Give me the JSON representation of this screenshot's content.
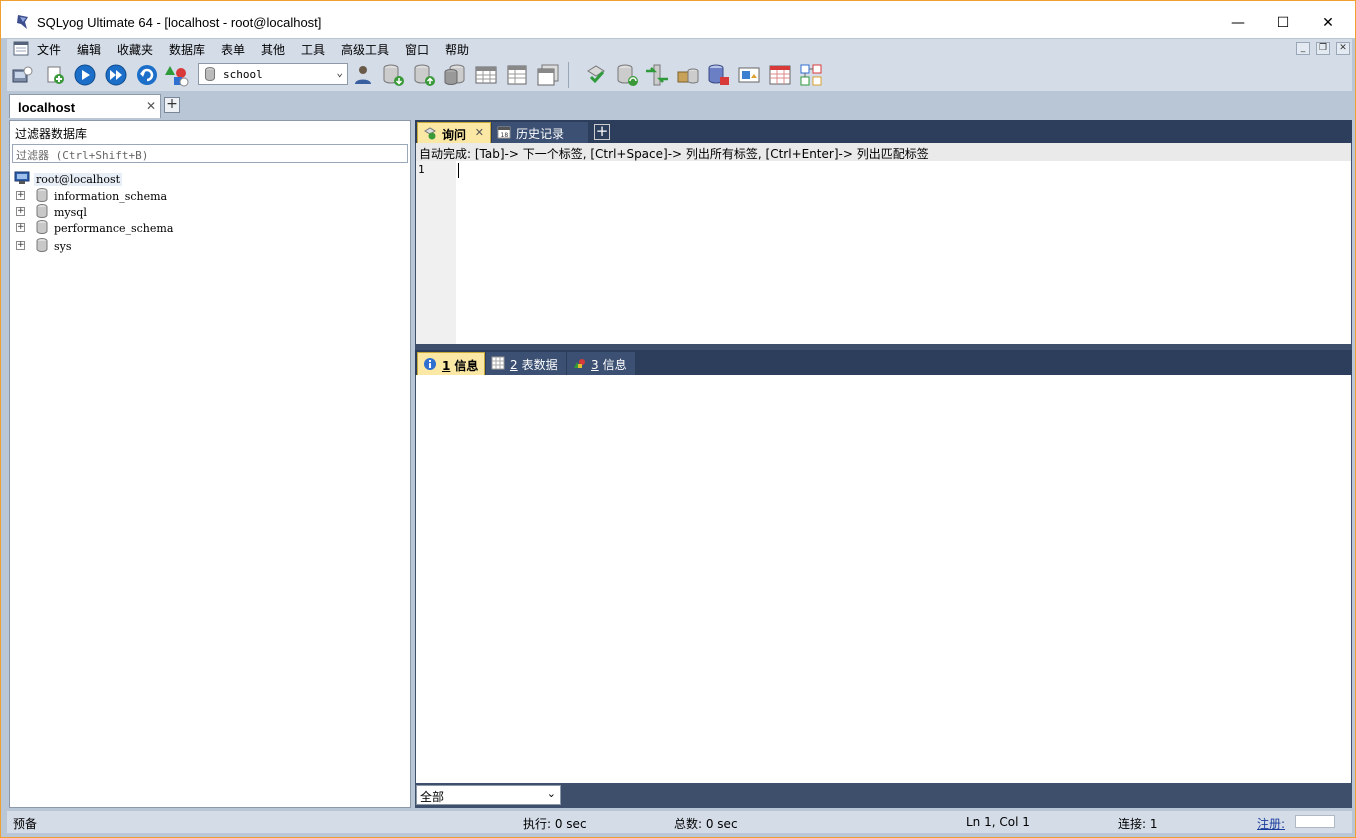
{
  "window": {
    "title": "SQLyog Ultimate 64 - [localhost - root@localhost]",
    "controls": {
      "minimize": "—",
      "maximize": "☐",
      "close": "✕"
    }
  },
  "menubar": {
    "items": [
      "文件",
      "编辑",
      "收藏夹",
      "数据库",
      "表单",
      "其他",
      "工具",
      "高级工具",
      "窗口",
      "帮助"
    ],
    "mdi": {
      "minimize": "_",
      "restore": "❐",
      "close": "✕"
    }
  },
  "toolbar": {
    "database_select": "school"
  },
  "connection_tabs": {
    "active": "localhost",
    "close": "✕",
    "add": "+"
  },
  "object_browser": {
    "title": "过滤器数据库",
    "filter_placeholder": "过滤器 (Ctrl+Shift+B)",
    "root": "root@localhost",
    "databases": [
      "information_schema",
      "mysql",
      "performance_schema",
      "sys"
    ],
    "expander": "+"
  },
  "query_tabs": {
    "tabs": [
      {
        "label": "询问",
        "active": true,
        "close": "✕"
      },
      {
        "label": "历史记录",
        "active": false
      }
    ],
    "add": "+"
  },
  "editor": {
    "hint": "自动完成: [Tab]-> 下一个标签, [Ctrl+Space]-> 列出所有标签, [Ctrl+Enter]-> 列出匹配标签",
    "line_number": "1"
  },
  "result_tabs": [
    {
      "num": "1",
      "label": "信息",
      "active": true
    },
    {
      "num": "2",
      "label": "表数据",
      "active": false
    },
    {
      "num": "3",
      "label": "信息",
      "active": false
    }
  ],
  "result_filter": {
    "value": "全部"
  },
  "statusbar": {
    "ready": "预备",
    "exec": "执行: 0 sec",
    "total": "总数: 0 sec",
    "position": "Ln 1, Col 1",
    "connections": "连接: 1",
    "register": "注册:"
  },
  "colors": {
    "frame": "#b9c6d6",
    "panel_dark": "#2c3e5c",
    "tab_active": "#fbe8a5",
    "window_border": "#f0a030"
  }
}
